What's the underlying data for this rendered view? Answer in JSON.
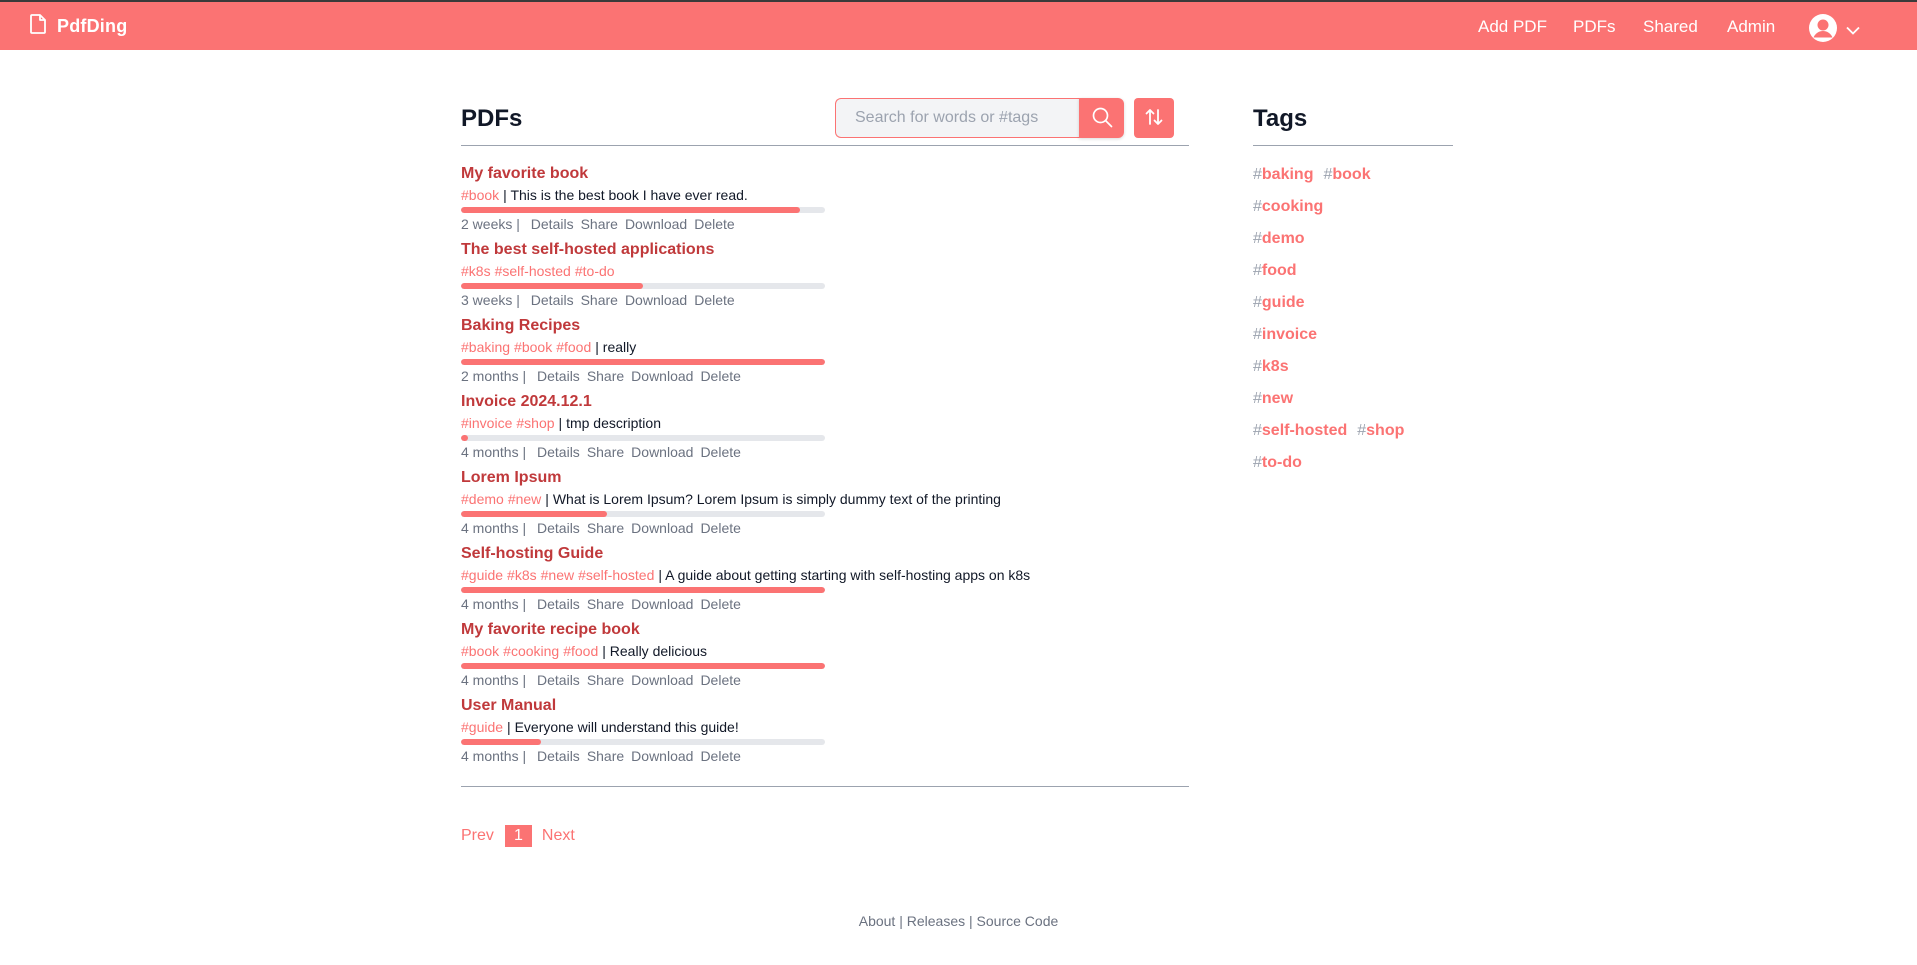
{
  "brand": {
    "title": "PdfDing"
  },
  "nav": {
    "add_pdf": "Add PDF",
    "pdfs": "PDFs",
    "shared": "Shared",
    "admin": "Admin"
  },
  "main": {
    "title": "PDFs",
    "search_placeholder": "Search for words or #tags"
  },
  "actions": {
    "details": "Details",
    "share": "Share",
    "download": "Download",
    "delete": "Delete"
  },
  "pdfs": [
    {
      "name": "My favorite book",
      "tags": [
        "#book"
      ],
      "description": "This is the best book I have ever read.",
      "progress": 0.93,
      "age": "2 weeks"
    },
    {
      "name": "The best self-hosted applications",
      "tags": [
        "#k8s",
        "#self-hosted",
        "#to-do"
      ],
      "description": "",
      "progress": 0.5,
      "age": "3 weeks"
    },
    {
      "name": "Baking Recipes",
      "tags": [
        "#baking",
        "#book",
        "#food"
      ],
      "description": "really",
      "progress": 1.0,
      "age": "2 months"
    },
    {
      "name": "Invoice 2024.12.1",
      "tags": [
        "#invoice",
        "#shop"
      ],
      "description": "tmp description",
      "progress": 0.02,
      "age": "4 months"
    },
    {
      "name": "Lorem Ipsum",
      "tags": [
        "#demo",
        "#new"
      ],
      "description": "What is Lorem Ipsum? Lorem Ipsum is simply dummy text of the printing",
      "progress": 0.4,
      "age": "4 months"
    },
    {
      "name": "Self-hosting Guide",
      "tags": [
        "#guide",
        "#k8s",
        "#new",
        "#self-hosted"
      ],
      "description": "A guide about getting starting with self-hosting apps on k8s",
      "progress": 1.0,
      "age": "4 months"
    },
    {
      "name": "My favorite recipe book",
      "tags": [
        "#book",
        "#cooking",
        "#food"
      ],
      "description": "Really delicious",
      "progress": 1.0,
      "age": "4 months"
    },
    {
      "name": "User Manual",
      "tags": [
        "#guide"
      ],
      "description": "Everyone will understand this guide!",
      "progress": 0.22,
      "age": "4 months"
    }
  ],
  "pagination": {
    "prev": "Prev",
    "current": "1",
    "next": "Next"
  },
  "tags_panel": {
    "title": "Tags",
    "rows": [
      [
        "baking",
        "book"
      ],
      [
        "cooking"
      ],
      [
        "demo"
      ],
      [
        "food"
      ],
      [
        "guide"
      ],
      [
        "invoice"
      ],
      [
        "k8s"
      ],
      [
        "new"
      ],
      [
        "self-hosted",
        "shop"
      ],
      [
        "to-do"
      ]
    ]
  },
  "footer": {
    "about": "About",
    "releases": "Releases",
    "source_code": "Source Code"
  },
  "colors": {
    "accent": "#fb7373",
    "title": "#c0393b"
  }
}
